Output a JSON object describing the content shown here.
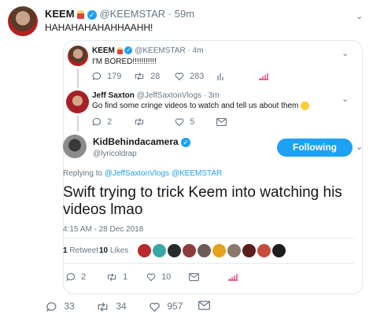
{
  "main_tweet": {
    "name": "KEEM",
    "handle": "@KEEMSTAR",
    "time": "· 59m",
    "text": "HAHAHAHAHAHHAAHH!",
    "stats": {
      "replies": "33",
      "retweets": "34",
      "likes": "957"
    }
  },
  "quoted_thread": [
    {
      "name": "KEEM",
      "handle": "@KEEMSTAR",
      "time": "· 4m",
      "text": "I'M BORED!!!!!!!!!!!",
      "stats": {
        "replies": "179",
        "retweets": "28",
        "likes": "283"
      }
    },
    {
      "name": "Jeff Saxton",
      "handle": "@JeffSaxtonVlogs",
      "time": "· 3m",
      "text": "Go find some cringe videos to watch and tell us about them",
      "stats": {
        "replies": "2",
        "retweets": "",
        "likes": "5"
      }
    }
  ],
  "focus_tweet": {
    "name": "KidBehindacamera",
    "handle": "@lyricoldrap",
    "follow_label": "Following",
    "replying_prefix": "Replying to",
    "replying_to": "@JeffSaxtonVlogs @KEEMSTAR",
    "text_line1": "Swift trying to trick Keem into watching his",
    "text_line2": "videos lmao",
    "timestamp": "4:15 AM - 28 Dec 2018",
    "retweets_count": "1",
    "retweets_label": "Retweet",
    "likes_count": "10",
    "likes_label": "Likes",
    "stats": {
      "replies": "2",
      "retweets": "1",
      "likes": "10"
    }
  },
  "colors": {
    "accent": "#1da1f2",
    "muted": "#657786",
    "border": "#e1e8ed",
    "analytics": "#e0245e"
  }
}
